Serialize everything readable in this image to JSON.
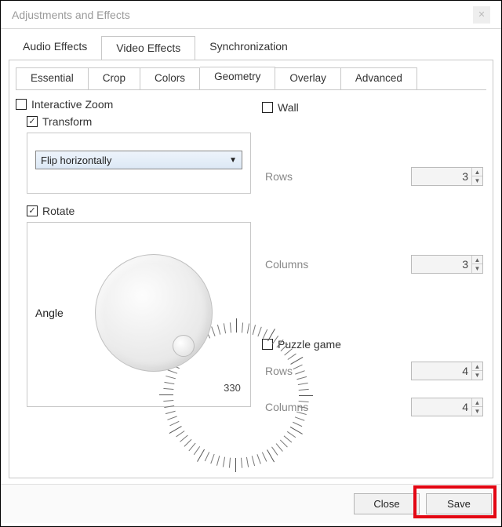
{
  "window": {
    "title": "Adjustments and Effects"
  },
  "tabs_primary": {
    "audio": "Audio Effects",
    "video": "Video Effects",
    "sync": "Synchronization",
    "active": "video"
  },
  "tabs_secondary": {
    "essential": "Essential",
    "crop": "Crop",
    "colors": "Colors",
    "geometry": "Geometry",
    "overlay": "Overlay",
    "advanced": "Advanced",
    "active": "geometry"
  },
  "geometry": {
    "interactive_zoom": {
      "label": "Interactive Zoom",
      "checked": false
    },
    "transform": {
      "label": "Transform",
      "checked": true,
      "selected": "Flip horizontally"
    },
    "rotate": {
      "label": "Rotate",
      "checked": true,
      "angle_label": "Angle",
      "max_label": "330"
    },
    "wall": {
      "label": "Wall",
      "checked": false,
      "rows_label": "Rows",
      "rows_value": "3",
      "cols_label": "Columns",
      "cols_value": "3"
    },
    "puzzle": {
      "label": "Puzzle game",
      "checked": false,
      "rows_label": "Rows",
      "rows_value": "4",
      "cols_label": "Columns",
      "cols_value": "4"
    }
  },
  "footer": {
    "close": "Close",
    "save": "Save"
  }
}
